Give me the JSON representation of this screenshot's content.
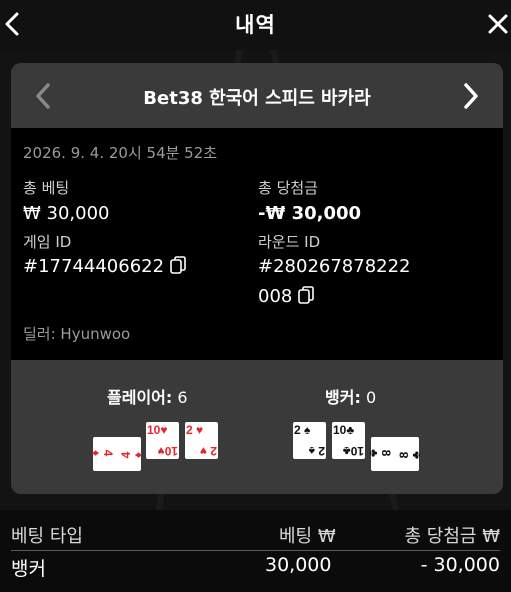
{
  "header": {
    "title": "내역",
    "back_icon": "chevron-left-icon",
    "close_icon": "close-icon"
  },
  "game": {
    "title": "Bet38 한국어 스피드 바카라",
    "date": "2026. 9. 4. 20시 54분 52초",
    "total_bet_label": "총 베팅",
    "total_bet_value": "₩ 30,000",
    "total_win_label": "총 당첨금",
    "total_win_value": "-₩ 30,000",
    "game_id_label": "게임 ID",
    "game_id_value": "#17744406622",
    "round_id_label": "라운드 ID",
    "round_id_line1": "#280267878222",
    "round_id_line2": "008",
    "dealer": "딜러: Hyunwoo"
  },
  "result": {
    "player_label": "플레이어:",
    "player_score": "6",
    "banker_label": "뱅커:",
    "banker_score": "0",
    "player_cards": [
      {
        "rank": "4",
        "suit": "♦",
        "color": "red",
        "rotated": true
      },
      {
        "rank": "10",
        "suit": "♥",
        "color": "red",
        "rotated": false
      },
      {
        "rank": "2",
        "suit": "♥",
        "color": "red",
        "rotated": false
      }
    ],
    "banker_cards": [
      {
        "rank": "2",
        "suit": "♠",
        "color": "black",
        "rotated": false
      },
      {
        "rank": "10",
        "suit": "♣",
        "color": "black",
        "rotated": false
      },
      {
        "rank": "8",
        "suit": "♣",
        "color": "black",
        "rotated": true
      }
    ]
  },
  "bets_table": {
    "headers": [
      "베팅 타입",
      "베팅 ₩",
      "총 당첨금 ₩"
    ],
    "rows": [
      [
        "뱅커",
        "30,000",
        "- 30,000"
      ]
    ]
  },
  "colors": {
    "background": "#0b0b0b",
    "card": "#2e2e2e",
    "panel": "#3a3a3a",
    "red_suit": "#e4262c"
  }
}
